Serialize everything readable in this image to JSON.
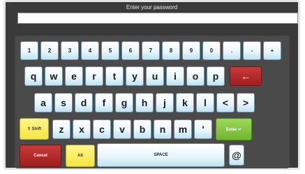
{
  "prompt": "Enter your password",
  "password_value": "",
  "rows": {
    "numbers": [
      "1",
      "2",
      "3",
      "4",
      "5",
      "6",
      "7",
      "8",
      "9",
      "0",
      ".",
      "-",
      "+"
    ],
    "row1": [
      "q",
      "w",
      "e",
      "r",
      "t",
      "y",
      "u",
      "i",
      "o",
      "p"
    ],
    "row2": [
      "a",
      "s",
      "d",
      "f",
      "g",
      "h",
      "j",
      "k",
      "l",
      "<",
      ">"
    ],
    "row3": [
      "z",
      "x",
      "c",
      "v",
      "b",
      "n",
      "m",
      "'"
    ]
  },
  "labels": {
    "backspace": "←",
    "shift": "⇧ Shift",
    "enter": "Enter ↵",
    "cancel": "Cancel",
    "alt": "Alt",
    "space": "SPACE",
    "at": "@"
  },
  "colors": {
    "red": "#b02828",
    "yellow": "#f6e84a",
    "green": "#7cc23a",
    "key": "#e8f5fb"
  }
}
